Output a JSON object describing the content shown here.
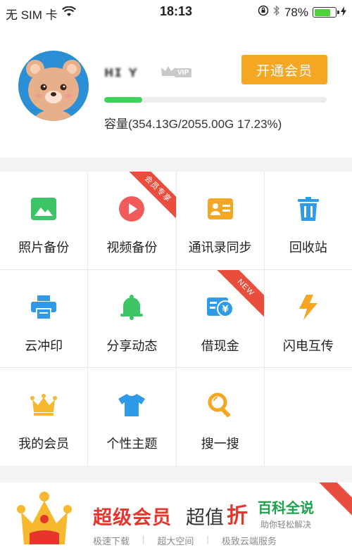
{
  "status_bar": {
    "carrier": "无 SIM 卡",
    "time": "18:13",
    "battery_text": "78%",
    "battery_level": 0.78
  },
  "profile": {
    "username": "ʜɪ ʏ",
    "vip_label": "VIP",
    "open_vip_button": "开通会员",
    "storage_used_fraction": 0.1723,
    "capacity_text": "容量(354.13G/2055.00G 17.23%)"
  },
  "grid": {
    "items": [
      {
        "label": "照片备份",
        "icon": "photo-icon"
      },
      {
        "label": "视频备份",
        "icon": "video-play-icon",
        "ribbon": "会员专享"
      },
      {
        "label": "通讯录同步",
        "icon": "contact-card-icon"
      },
      {
        "label": "回收站",
        "icon": "trash-icon"
      },
      {
        "label": "云冲印",
        "icon": "printer-icon"
      },
      {
        "label": "分享动态",
        "icon": "bell-icon"
      },
      {
        "label": "借现金",
        "icon": "yuan-card-icon",
        "ribbon": "NEW"
      },
      {
        "label": "闪电互传",
        "icon": "lightning-icon"
      },
      {
        "label": "我的会员",
        "icon": "crown-icon"
      },
      {
        "label": "个性主题",
        "icon": "tshirt-icon"
      },
      {
        "label": "搜一搜",
        "icon": "magnifier-icon"
      },
      {
        "label": "",
        "icon": ""
      }
    ]
  },
  "banner": {
    "title": "超级会员",
    "subtitle": "超值",
    "subtitle_tail": "折",
    "features": [
      "极速下载",
      "超大空间",
      "极致云端服务"
    ],
    "watermark_big": "百科全说",
    "watermark_small": "助你轻松解决"
  },
  "colors": {
    "accent_orange": "#f5a623",
    "progress_green": "#3fd35b",
    "ribbon_red": "#e94e3c",
    "banner_red": "#e5352c"
  }
}
